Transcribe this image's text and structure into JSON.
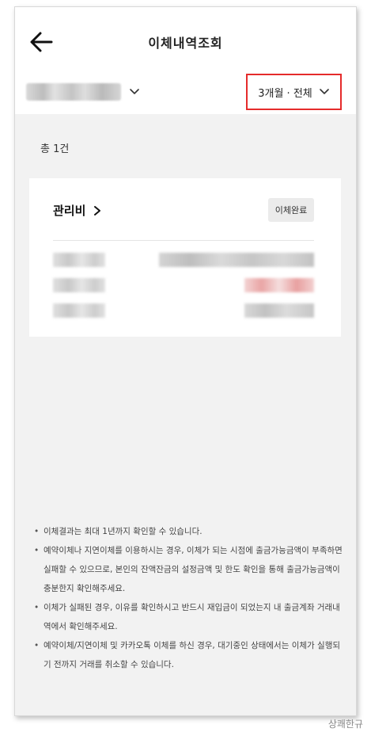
{
  "header": {
    "title": "이체내역조회"
  },
  "filter": {
    "period_label": "3개월 · 전체"
  },
  "summary": {
    "total_label": "총 1건"
  },
  "card": {
    "title": "관리비",
    "status": "이체완료"
  },
  "notices": [
    "이체결과는 최대 1년까지 확인할 수 있습니다.",
    "예약이체나 지연이체를 이용하시는 경우, 이체가 되는 시점에 출금가능금액이 부족하면 실패할 수 있으므로, 본인의 잔액잔금의 설정금액 및 한도 확인을 통해 출금가능금액이 충분한지 확인해주세요.",
    "이체가 실패된 경우, 이유를 확인하시고 반드시 재입금이 되었는지 내 출금계좌 거래내역에서 확인해주세요.",
    "예약이체/지연이체 및 카카오톡 이체를 하신 경우, 대기중인 상태에서는 이체가 실행되기 전까지 거래를 취소할 수 있습니다."
  ],
  "watermark": "상쾌한규",
  "colors": {
    "highlight_border": "#e52b2b",
    "background": "#f2f2f2"
  },
  "icons": {
    "back": "arrow-left-icon",
    "dropdown": "chevron-down-icon",
    "detail": "chevron-right-icon"
  }
}
